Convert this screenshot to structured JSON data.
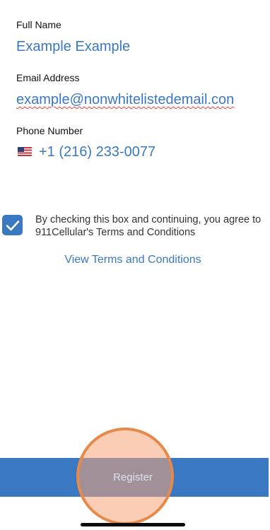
{
  "form": {
    "full_name_label": "Full Name",
    "full_name_value": "Example Example",
    "email_label": "Email Address",
    "email_value": "example@nonwhitelistedemail.con",
    "phone_label": "Phone Number",
    "phone_value": "+1 (216) 233-0077",
    "phone_flag_icon": "us-flag-icon"
  },
  "terms": {
    "checkbox_checked": true,
    "agreement_text": "By checking this box and continuing, you agree to 911Cellular's Terms and Conditions",
    "view_link": "View Terms and Conditions"
  },
  "footer": {
    "register_label": "Register"
  },
  "colors": {
    "accent": "#3a78c2",
    "tap_highlight": "#f7a478",
    "spellcheck": "#e0403a"
  }
}
